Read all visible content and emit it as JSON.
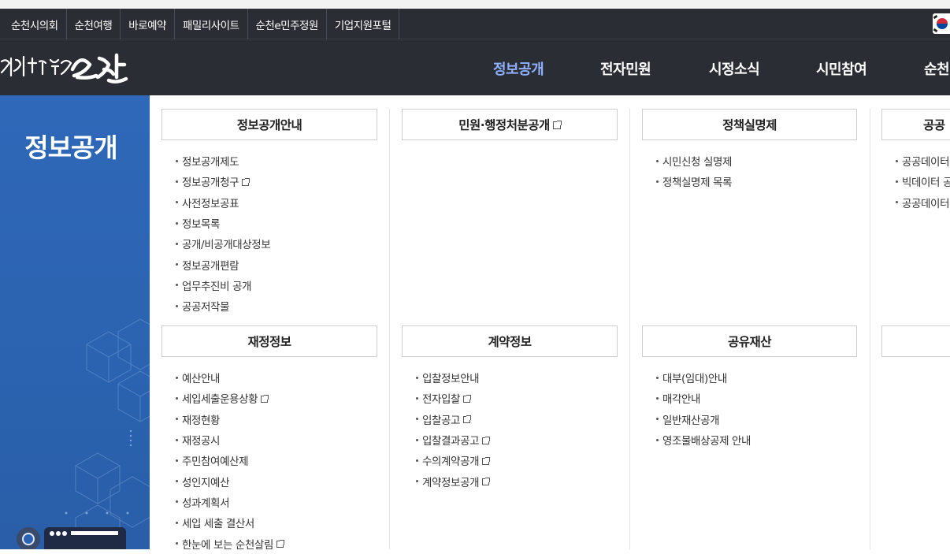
{
  "util_links": [
    "순천시의회",
    "순천여행",
    "바로예약",
    "패밀리사이트",
    "순천e민주정원",
    "기업지원포털"
  ],
  "logo_text": "대한민국 생태수도 일류 순천",
  "gnb": {
    "items": [
      "정보공개",
      "전자민원",
      "시정소식",
      "시민참여",
      "순천"
    ],
    "active": "정보공개"
  },
  "side_title": "정보공개",
  "sections": [
    {
      "title": "정보공개안내",
      "ext": false,
      "items": [
        {
          "label": "정보공개제도",
          "ext": false
        },
        {
          "label": "정보공개청구",
          "ext": true
        },
        {
          "label": "사전정보공표",
          "ext": false
        },
        {
          "label": "정보목록",
          "ext": false
        },
        {
          "label": "공개/비공개대상정보",
          "ext": false
        },
        {
          "label": "정보공개편람",
          "ext": false
        },
        {
          "label": "업무추진비 공개",
          "ext": false
        },
        {
          "label": "공공저작물",
          "ext": false
        }
      ]
    },
    {
      "title": "민원·행정처분공개",
      "ext": true,
      "items": []
    },
    {
      "title": "정책실명제",
      "ext": false,
      "items": [
        {
          "label": "시민신청 실명제",
          "ext": false
        },
        {
          "label": "정책실명제 목록",
          "ext": false
        }
      ]
    },
    {
      "title": "공공",
      "ext": false,
      "items": [
        {
          "label": "공공데이터",
          "ext": false
        },
        {
          "label": "빅데이터 공",
          "ext": false
        },
        {
          "label": "공공데이터",
          "ext": false
        }
      ]
    },
    {
      "title": "재정정보",
      "ext": false,
      "items": [
        {
          "label": "예산안내",
          "ext": false
        },
        {
          "label": "세입세출운용상황",
          "ext": true
        },
        {
          "label": "재정현황",
          "ext": false
        },
        {
          "label": "재정공시",
          "ext": false
        },
        {
          "label": "주민참여예산제",
          "ext": false
        },
        {
          "label": "성인지예산",
          "ext": false
        },
        {
          "label": "성과계획서",
          "ext": false
        },
        {
          "label": "세입 세출 결산서",
          "ext": false
        },
        {
          "label": "한눈에 보는 순천살림",
          "ext": true
        }
      ]
    },
    {
      "title": "계약정보",
      "ext": false,
      "items": [
        {
          "label": "입찰정보안내",
          "ext": false
        },
        {
          "label": "전자입찰",
          "ext": true
        },
        {
          "label": "입찰공고",
          "ext": true
        },
        {
          "label": "입찰결과공고",
          "ext": true
        },
        {
          "label": "수의계약공개",
          "ext": true
        },
        {
          "label": "계약정보공개",
          "ext": true
        }
      ]
    },
    {
      "title": "공유재산",
      "ext": false,
      "items": [
        {
          "label": "대부(임대)안내",
          "ext": false
        },
        {
          "label": "매각안내",
          "ext": false
        },
        {
          "label": "일반재산공개",
          "ext": false
        },
        {
          "label": "영조물배상공제 안내",
          "ext": false
        }
      ]
    },
    {
      "title": "",
      "ext": false,
      "items": []
    }
  ],
  "colors": {
    "header_bg": "#2a2d33",
    "side_bg": "#2b63b0",
    "active_menu": "#8fb0ff"
  }
}
